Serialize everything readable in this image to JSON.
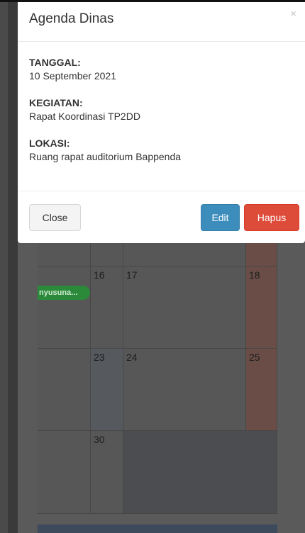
{
  "modal": {
    "title": "Agenda Dinas",
    "close_icon": "×",
    "fields": [
      {
        "label": "TANGGAL:",
        "value": "10 September 2021"
      },
      {
        "label": "KEGIATAN:",
        "value": "Rapat Koordinasi TP2DD"
      },
      {
        "label": "LOKASI:",
        "value": "Ruang rapat auditorium Bappenda"
      }
    ],
    "buttons": {
      "close": "Close",
      "edit": "Edit",
      "delete": "Hapus"
    }
  },
  "calendar": {
    "days": [
      "16",
      "17",
      "18",
      "23",
      "24",
      "25",
      "30"
    ],
    "event_label": "nyusuna...",
    "colors": {
      "event": "#2a8a3a",
      "holiday": "#6a4d47",
      "primary": "#3c8dbc",
      "danger": "#dd4b39"
    }
  }
}
